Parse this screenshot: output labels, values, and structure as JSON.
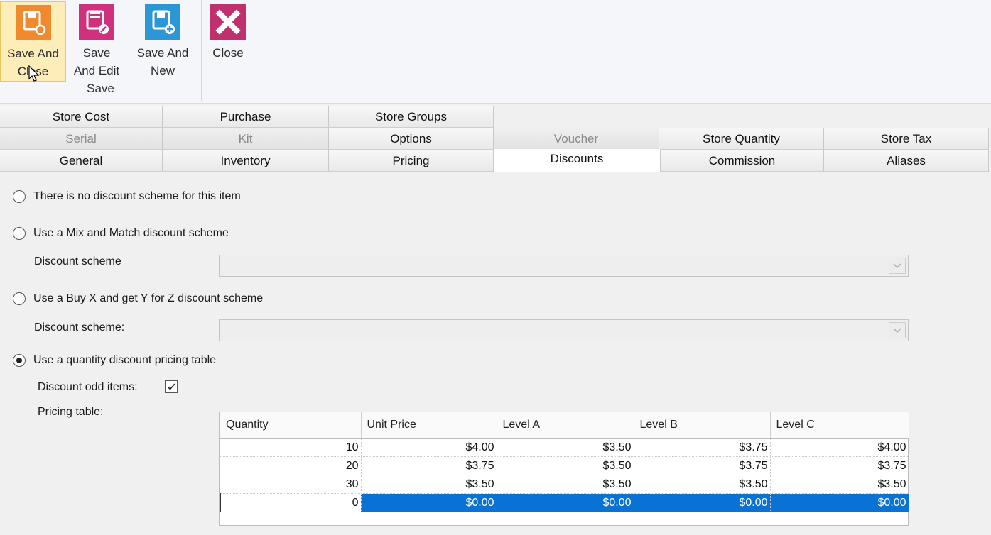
{
  "ribbon": {
    "save_and_close": {
      "line1": "Save And",
      "line2": "Close"
    },
    "save_and_edit": {
      "line1": "Save",
      "line2": "And Edit"
    },
    "save_and_new": {
      "line1": "Save And",
      "line2": "New"
    },
    "close": {
      "line1": "Close"
    },
    "group_label": "Save",
    "colors": {
      "save_close": "#f08a2c",
      "save_edit": "#d0317c",
      "save_new": "#2c97d6",
      "close": "#c0306e"
    }
  },
  "tabs": {
    "row1": [
      "Store Cost",
      "Purchase",
      "Store Groups"
    ],
    "row2": [
      "Serial",
      "Kit",
      "Options",
      "Voucher",
      "Store Quantity",
      "Store Tax"
    ],
    "row3": [
      "General",
      "Inventory",
      "Pricing",
      "Discounts",
      "Commission",
      "Aliases"
    ]
  },
  "discounts": {
    "no_scheme_label": "There is no discount scheme for this item",
    "mix_match_label": "Use a Mix and Match discount scheme",
    "mix_match_scheme_label": "Discount scheme",
    "buy_x_label": "Use a Buy X and get Y for Z discount scheme",
    "buy_x_scheme_label": "Discount scheme:",
    "qty_table_label": "Use a quantity discount pricing table",
    "odd_items_label": "Discount odd items:",
    "pricing_table_label": "Pricing table:",
    "selected_option": "qty_table",
    "odd_items_checked": true
  },
  "pricing_table": {
    "columns": [
      "Quantity",
      "Unit Price",
      "Level A",
      "Level B",
      "Level C"
    ],
    "rows": [
      [
        "10",
        "$4.00",
        "$3.50",
        "$3.75",
        "$4.00"
      ],
      [
        "20",
        "$3.75",
        "$3.50",
        "$3.75",
        "$3.75"
      ],
      [
        "30",
        "$3.50",
        "$3.50",
        "$3.50",
        "$3.50"
      ],
      [
        "0",
        "$0.00",
        "$0.00",
        "$0.00",
        "$0.00"
      ]
    ],
    "selected_row": 3
  }
}
